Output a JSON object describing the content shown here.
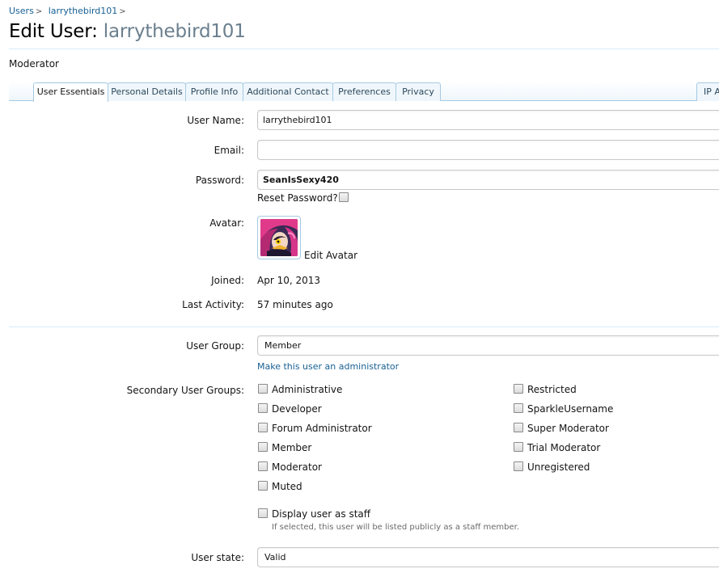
{
  "breadcrumb": {
    "items": [
      "Users",
      "larrythebird101"
    ],
    "separator": ">"
  },
  "header": {
    "title_prefix": "Edit User:",
    "title_username": "larrythebird101",
    "subtitle": "Moderator"
  },
  "tabs": [
    {
      "label": "User Essentials",
      "active": true
    },
    {
      "label": "Personal Details",
      "active": false
    },
    {
      "label": "Profile Info",
      "active": false
    },
    {
      "label": "Additional Contact",
      "active": false
    },
    {
      "label": "Preferences",
      "active": false
    },
    {
      "label": "Privacy",
      "active": false
    },
    {
      "label": "IP A",
      "active": false
    }
  ],
  "form": {
    "username": {
      "label": "User Name:",
      "value": "larrythebird101"
    },
    "email": {
      "label": "Email:",
      "value": ""
    },
    "password": {
      "label": "Password:",
      "value": "SeanIsSexy420"
    },
    "reset_password": {
      "label": "Reset Password?",
      "checked": false
    },
    "avatar": {
      "label": "Avatar:",
      "edit_link": "Edit Avatar"
    },
    "joined": {
      "label": "Joined:",
      "value": "Apr 10, 2013"
    },
    "last_activity": {
      "label": "Last Activity:",
      "value": "57 minutes ago"
    },
    "user_group": {
      "label": "User Group:",
      "value": "Member",
      "make_admin_link": "Make this user an administrator"
    },
    "secondary_groups": {
      "label": "Secondary User Groups:",
      "left": [
        "Administrative",
        "Developer",
        "Forum Administrator",
        "Member",
        "Moderator",
        "Muted"
      ],
      "right": [
        "Restricted",
        "SparkleUsername",
        "Super Moderator",
        "Trial Moderator",
        "Unregistered"
      ]
    },
    "display_staff": {
      "label": "Display user as staff",
      "checked": false,
      "hint": "If selected, this user will be listed publicly as a staff member."
    },
    "user_state": {
      "label": "User state:",
      "value": "Valid"
    }
  },
  "colors": {
    "link": "#176093",
    "tab_border": "#a5cae4",
    "rule": "#d7edfc",
    "username_grey": "#6a7f8e"
  }
}
